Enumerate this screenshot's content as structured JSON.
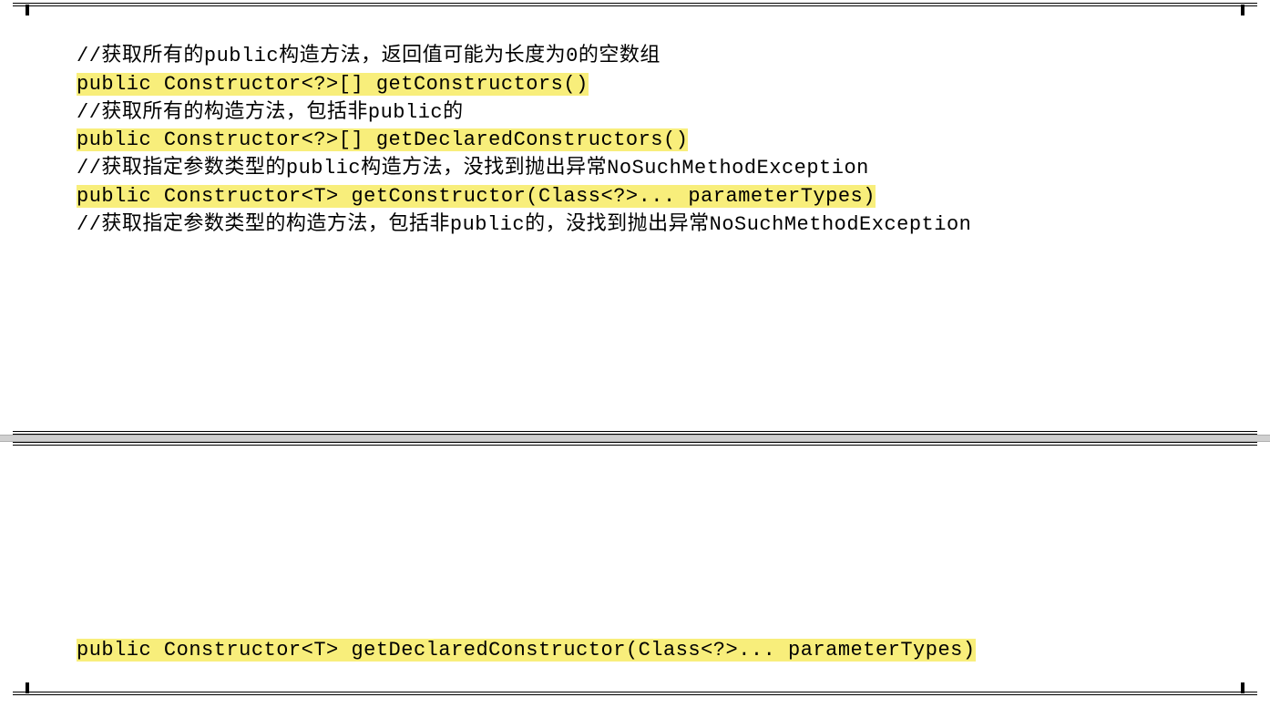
{
  "block1": {
    "lines": [
      {
        "text": "//获取所有的public构造方法，返回值可能为长度为0的空数组",
        "highlight": false
      },
      {
        "text": "public Constructor<?>[] getConstructors()",
        "highlight": true
      },
      {
        "text": "//获取所有的构造方法，包括非public的",
        "highlight": false
      },
      {
        "text": "public Constructor<?>[] getDeclaredConstructors()",
        "highlight": true
      },
      {
        "text": "//获取指定参数类型的public构造方法，没找到抛出异常NoSuchMethodException",
        "highlight": false
      },
      {
        "text": "public Constructor<T> getConstructor(Class<?>... parameterTypes)",
        "highlight": true
      },
      {
        "text": "//获取指定参数类型的构造方法，包括非public的，没找到抛出异常NoSuchMethodException",
        "highlight": false
      }
    ]
  },
  "block2": {
    "lines": [
      {
        "text": "public Constructor<T> getDeclaredConstructor(Class<?>... parameterTypes)",
        "highlight": true
      }
    ]
  }
}
